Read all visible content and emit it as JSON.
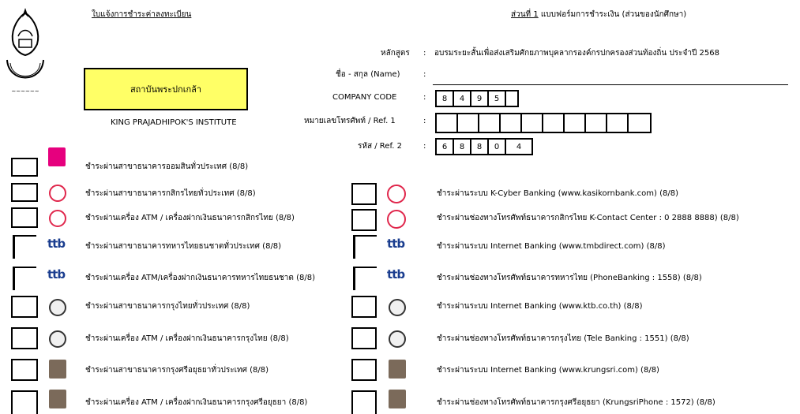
{
  "header": {
    "left_title": "ใบแจ้งการชำระค่าลงทะเบียน",
    "right_title_bold": "ส่วนที่ 1",
    "right_title_rest": " แบบฟอร์มการชำระเงิน (ส่วนของนักศึกษา)",
    "institute_th": "สถาบันพระปกเกล้า",
    "institute_en": "KING PRAJADHIPOK'S INSTITUTE"
  },
  "form": {
    "course_label": "หลักสูตร",
    "course_value": "อบรมระยะสั้นเพื่อส่งเสริมศักยภาพบุคลากรองค์กรปกครองส่วนท้องถิ่น ประจำปี 2568",
    "name_label": "ชื่อ - สกุล (Name)",
    "company_label": "COMPANY CODE",
    "company_code": [
      "8",
      "4",
      "9",
      "5"
    ],
    "ref1_label": "หมายเลขโทรศัพท์ / Ref. 1",
    "ref1_cells": [
      "",
      "",
      "",
      "",
      "",
      "",
      "",
      "",
      "",
      ""
    ],
    "ref2_label": "รหัส / Ref. 2",
    "ref2_code": [
      "6",
      "8",
      "8",
      "0",
      "4"
    ],
    "colon": ":"
  },
  "payment_left": [
    {
      "icon": "gsb-logo-icon",
      "label": "ชำระผ่านสาขาธนาคารออมสินทั่วประเทศ (8/8)"
    },
    {
      "icon": "kbank-logo-icon",
      "label": "ชำระผ่านสาขาธนาคารกสิกรไทยทั่วประเทศ (8/8)"
    },
    {
      "icon": "kbank-logo-icon",
      "label": "ชำระผ่านเครื่อง ATM / เครื่องฝากเงินธนาคารกสิกรไทย (8/8)"
    },
    {
      "icon": "ttb-logo-icon",
      "label": "ชำระผ่านสาขาธนาคารทหารไทยธนชาตทั่วประเทศ (8/8)"
    },
    {
      "icon": "ttb-logo-icon",
      "label": "ชำระผ่านเครื่อง ATM/เครื่องฝากเงินธนาคารทหารไทยธนชาต (8/8)"
    },
    {
      "icon": "ktb-logo-icon",
      "label": "ชำระผ่านสาขาธนาคารกรุงไทยทั่วประเทศ (8/8)"
    },
    {
      "icon": "ktb-logo-icon",
      "label": "ชำระผ่านเครื่อง ATM / เครื่องฝากเงินธนาคารกรุงไทย (8/8)"
    },
    {
      "icon": "krungsri-logo-icon",
      "label": "ชำระผ่านสาขาธนาคารกรุงศรีอยุธยาทั่วประเทศ (8/8)"
    },
    {
      "icon": "krungsri-logo-icon",
      "label": "ชำระผ่านเครื่อง ATM / เครื่องฝากเงินธนาคารกรุงศรีอยุธยา (8/8)"
    }
  ],
  "payment_right": [
    {
      "icon": "kbank-logo-icon",
      "label": "ชำระผ่านระบบ K-Cyber Banking (www.kasikornbank.com) (8/8)"
    },
    {
      "icon": "kbank-logo-icon",
      "label": "ชำระผ่านช่องทางโทรศัพท์ธนาคารกสิกรไทย K-Contact Center : 0 2888 8888) (8/8)"
    },
    {
      "icon": "ttb-logo-icon",
      "label": "ชำระผ่านระบบ Internet Banking (www.tmbdirect.com) (8/8)"
    },
    {
      "icon": "ttb-logo-icon",
      "label": "ชำระผ่านช่องทางโทรศัพท์ธนาคารทหารไทย (PhoneBanking : 1558) (8/8)"
    },
    {
      "icon": "ktb-logo-icon",
      "label": "ชำระผ่านระบบ Internet Banking (www.ktb.co.th) (8/8)"
    },
    {
      "icon": "ktb-logo-icon",
      "label": "ชำระผ่านช่องทางโทรศัพท์ธนาคารกรุงไทย (Tele Banking : 1551) (8/8)"
    },
    {
      "icon": "krungsri-logo-icon",
      "label": "ชำระผ่านระบบ Internet Banking (www.krungsri.com) (8/8)"
    },
    {
      "icon": "krungsri-logo-icon",
      "label": "ชำระผ่านช่องทางโทรศัพท์ธนาคารกรุงศรีอยุธยา (KrungsriPhone : 1572) (8/8)"
    }
  ]
}
